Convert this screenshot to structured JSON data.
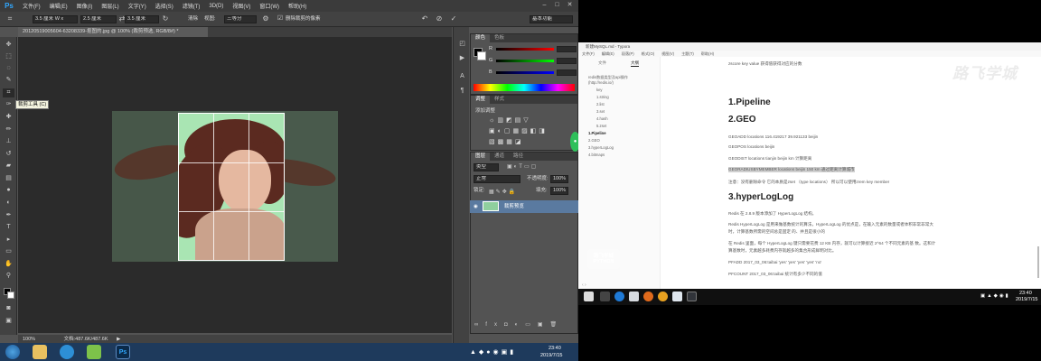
{
  "photoshop": {
    "logo": "Ps",
    "menu": [
      "文件(F)",
      "编辑(E)",
      "图像(I)",
      "图层(L)",
      "文字(Y)",
      "选择(S)",
      "滤镜(T)",
      "3D(D)",
      "视图(V)",
      "窗口(W)",
      "帮助(H)"
    ],
    "window_controls": [
      "–",
      "□",
      "✕"
    ],
    "options": {
      "width_value": "3.5 厘米 W x",
      "height_value": "2.5 厘米",
      "third_value": "3.5 厘米",
      "clear_label": "清除",
      "view_label": "视图:",
      "view_value": "三等分",
      "delete_cropped_label": "删除裁剪的像素",
      "workspace_value": "基本功能"
    },
    "doc_tab": "20120519005604-63208339-抠图的.jpg @ 100% (裁剪预选, RGB/8#) *",
    "tooltip": "裁剪工具 (C)",
    "status": {
      "zoom": "100%",
      "doc_size": "文档:487.6K/487.6K"
    },
    "color_panel": {
      "tabs": [
        "颜色",
        "色板"
      ],
      "r_label": "R",
      "g_label": "G",
      "b_label": "B"
    },
    "adjust_panel": {
      "tabs": [
        "调整",
        "样式"
      ],
      "add_label": "添加调整"
    },
    "layers_panel": {
      "tabs": [
        "图层",
        "通道",
        "路径"
      ],
      "kind_label": "类型",
      "blend_mode": "正常",
      "opacity_label": "不透明度:",
      "opacity_value": "100%",
      "lock_label": "锁定:",
      "fill_label": "填充:",
      "fill_value": "100%",
      "layer_name": "裁剪预览"
    },
    "taskbar": {
      "time": "23:40",
      "date": "2019/7/15"
    }
  },
  "typora": {
    "title": "新建MySQL.md - Typora",
    "menu": [
      "文件(F)",
      "编辑(E)",
      "段落(P)",
      "格式(O)",
      "视图(V)",
      "主题(T)",
      "帮助(H)"
    ],
    "side_tabs": [
      "文件",
      "大纲"
    ],
    "outline": [
      "redis数据类型及api操作",
      "(http://redis.io/)",
      "key",
      "1.string",
      "2.list",
      "3.set",
      "4.hash",
      "5.zset",
      "1.Pipeline",
      "2.GEO",
      "3.hyperLogLog",
      "4.bitmaps"
    ],
    "content": {
      "zset_line": "zscore key value  获得值获得对应的分数",
      "h_pipeline": "1.Pipeline",
      "h_geo": "2.GEO",
      "geo_add": "GEOADD locations 116.419217 39.921133 beijin",
      "geo_pos": "GEOPOS locations beijin",
      "geo_dist": "GEODIST locations tianjin beijin km        计算距离",
      "georadius": "GEORADIUSBYMEMBER locations beijin 150 km  通过距离计算城市",
      "note": "注意：没有删除命令  它的本质是zset （type locations）   所以可以使用zrem key member",
      "h_hll": "3.hyperLogLog",
      "hll_intro": "Redis 在 2.8.9 版本添加了 HyperLogLog 结构。",
      "hll_p1a": "Redis HyperLogLog 是用来做基数统计的算法，HyperLogLog 的优点是，在输入元素的数量或者体积非常非常大",
      "hll_p1b": "时，计算基数所需的空间总是固定 的、并且是很小的",
      "hll_p2a": "在 Redis 里面，每个 HyperLogLog 键只需要花费 12 KB 内存，就可以计算接近 2^64 个不同元素的基 数。这和计",
      "hll_p2b": "算基数时，元素越多耗费内存就越多的集合形成鲜明对比。",
      "pfadd": "PFADD 2017_03_06:taibai 'yes' 'yes' 'yes' 'yes' 'no'",
      "pfcount": "PFCOUNT 2017_03_06:taibai    统计有多少不同的值"
    },
    "watermark": "路飞学城",
    "taskbar": {
      "time": "23:40",
      "date": "2019/7/15"
    }
  },
  "floating_watermark": [
    "路飞学城",
    "PYTHON"
  ]
}
